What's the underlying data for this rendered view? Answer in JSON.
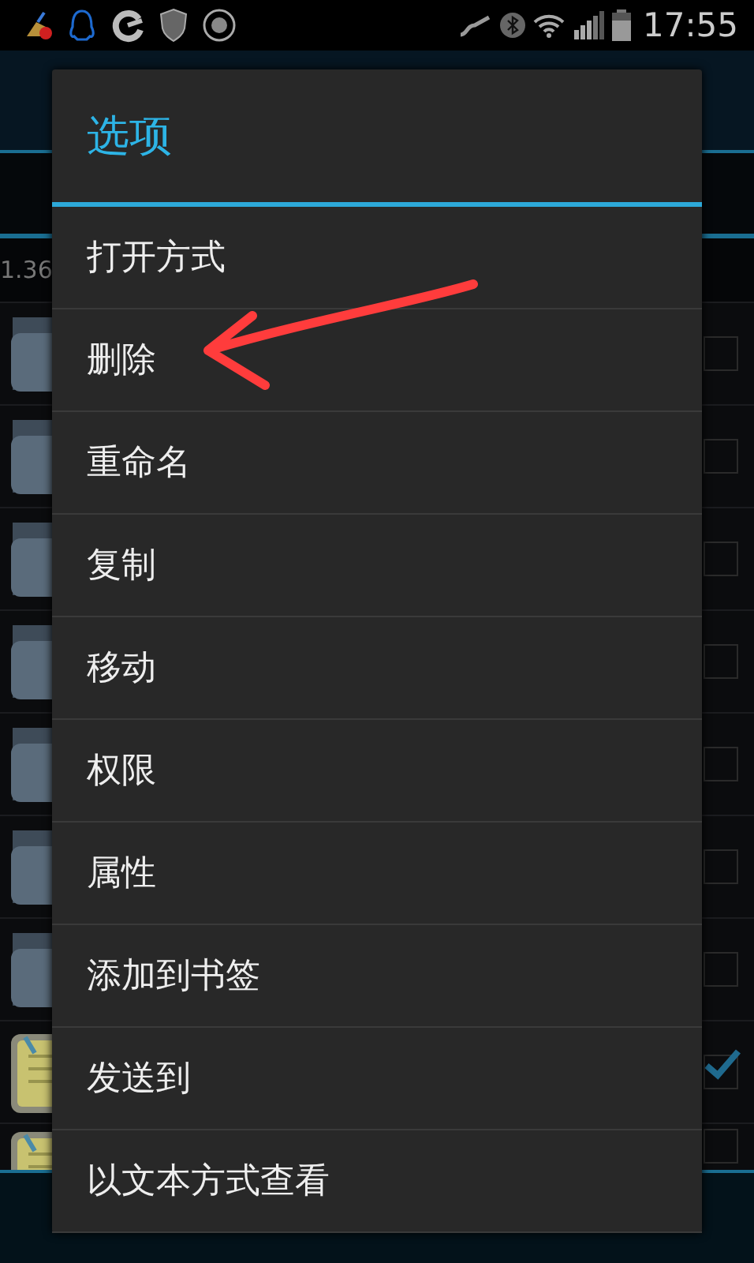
{
  "status_bar": {
    "time": "17:55"
  },
  "file_list": {
    "path": "1.36",
    "rows": [
      {
        "kind": "folder",
        "checked": false
      },
      {
        "kind": "folder",
        "checked": false
      },
      {
        "kind": "folder",
        "checked": false
      },
      {
        "kind": "folder",
        "checked": false
      },
      {
        "kind": "folder",
        "checked": false
      },
      {
        "kind": "folder",
        "checked": false
      },
      {
        "kind": "folder",
        "checked": false
      },
      {
        "kind": "note",
        "checked": true
      },
      {
        "kind": "note",
        "checked": false
      }
    ]
  },
  "dialog": {
    "title": "选项",
    "items": [
      {
        "label": "打开方式"
      },
      {
        "label": "删除"
      },
      {
        "label": "重命名"
      },
      {
        "label": "复制"
      },
      {
        "label": "移动"
      },
      {
        "label": "权限"
      },
      {
        "label": "属性"
      },
      {
        "label": "添加到书签"
      },
      {
        "label": "发送到"
      },
      {
        "label": "以文本方式查看"
      }
    ]
  }
}
